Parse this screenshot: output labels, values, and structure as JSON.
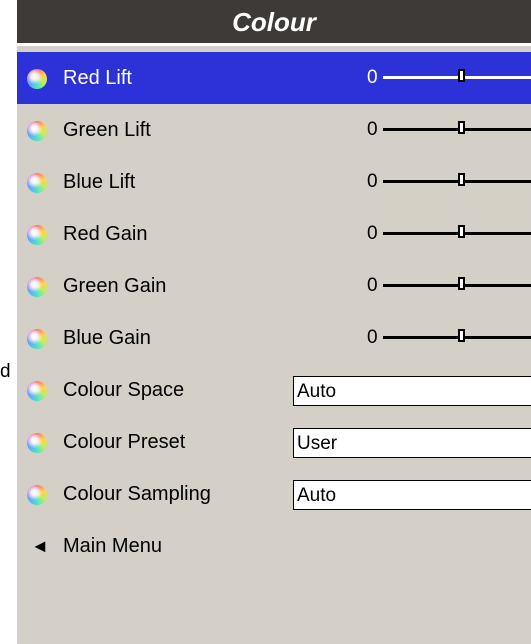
{
  "left_partial_text": "d",
  "title": "Colour",
  "slider_rows": [
    {
      "label": "Red Lift",
      "value": "0",
      "selected": true
    },
    {
      "label": "Green Lift",
      "value": "0",
      "selected": false
    },
    {
      "label": "Blue Lift",
      "value": "0",
      "selected": false
    },
    {
      "label": "Red Gain",
      "value": "0",
      "selected": false
    },
    {
      "label": "Green Gain",
      "value": "0",
      "selected": false
    },
    {
      "label": "Blue Gain",
      "value": "0",
      "selected": false
    }
  ],
  "select_rows": [
    {
      "label": "Colour Space",
      "value": "Auto"
    },
    {
      "label": "Colour Preset",
      "value": "User"
    },
    {
      "label": "Colour Sampling",
      "value": "Auto"
    }
  ],
  "back": {
    "arrow": "◄",
    "label": "Main Menu"
  },
  "icons": {
    "row_icon": "colour-ball-icon",
    "back_icon": "back-arrow-icon"
  },
  "colors": {
    "title_bg": "#3e3a37",
    "selected_bg": "#2d32d8",
    "panel_bg": "#d4d0c8"
  }
}
